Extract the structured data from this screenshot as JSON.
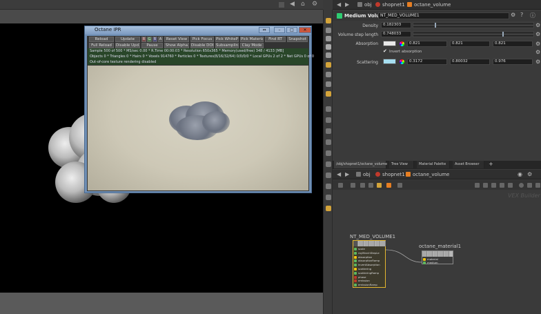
{
  "ipr": {
    "title": "Octane IPR",
    "buttons_row1": [
      "Reload",
      "Update",
      "R",
      "G",
      "B",
      "A",
      "Reset View",
      "Pick Focus",
      "Pick WhiteP",
      "Pick Material",
      "Find RT",
      "Snapshot"
    ],
    "buttons_row2": [
      "Full Reload",
      "Disable Upd.",
      "Pause",
      "Show Alpha",
      "Disable DOF",
      "Subsampling",
      "Clay Mode"
    ],
    "status_line1": "Sample 500 of 500 * MS/sec 0.00 * R.Time 00:00:03 * Resolution 650x365 * Memory(used/free) 348 / 4133 [MB]",
    "status_line2": "Objects 0 * Triangles 0 * Hairs 0 * Voxels 914760 * Particles 0 * Textures(8/16/32/64) 0/0/0/0 * Local GPUs 2 of 2 * Net GPUs 0 of 0",
    "status_line3": "Out-of-core texture rendering disabled",
    "window_buttons": [
      "⇔",
      "–",
      "□",
      "✕"
    ]
  },
  "top_path": {
    "obj": "obj",
    "shopnet": "shopnet1",
    "node": "octane_volume"
  },
  "parm_pane": {
    "node_type": "Medium Volume",
    "node_name": "NT_MED_VOLUME1",
    "density_label": "Density",
    "density_value": "0.182303",
    "density_fraction": 0.18,
    "step_label": "Volume step length",
    "step_value": "0.748033",
    "step_fraction": 0.75,
    "absorption_label": "Absorption",
    "absorption_color": "#e8e8e8",
    "absorption_values": [
      "0.821",
      "0.821",
      "0.821"
    ],
    "invert_label": "Invert absorption",
    "scattering_label": "Scattering",
    "scattering_color": "#a6def0",
    "scattering_values": [
      "0.3172",
      "0.80032",
      "0.976"
    ]
  },
  "net_tabs": [
    "/obj/shopnet1/octane_volume",
    "Tree View",
    "Material Palette",
    "Asset Browser"
  ],
  "net_path": {
    "obj": "obj",
    "shopnet": "shopnet1",
    "node": "octane_volume"
  },
  "net_label": "VEX Builder",
  "vol_node": {
    "name": "NT_MED_VOLUME1",
    "inputs": [
      "scale",
      "rayMarchStepLe",
      "absorption",
      "absorptionRamp",
      "invertAbsorption",
      "scattering",
      "scatteringRamp",
      "phase",
      "emission",
      "emissionRamp"
    ],
    "input_colors": [
      "#5fb85f",
      "#5fb85f",
      "#f1c40f",
      "#5fb85f",
      "#5fb85f",
      "#f1c40f",
      "#5fb85f",
      "#c0392b",
      "#c0392b",
      "#5fb85f"
    ]
  },
  "mat_node": {
    "name": "octane_material1",
    "inputs": [
      "material",
      "medium"
    ]
  }
}
